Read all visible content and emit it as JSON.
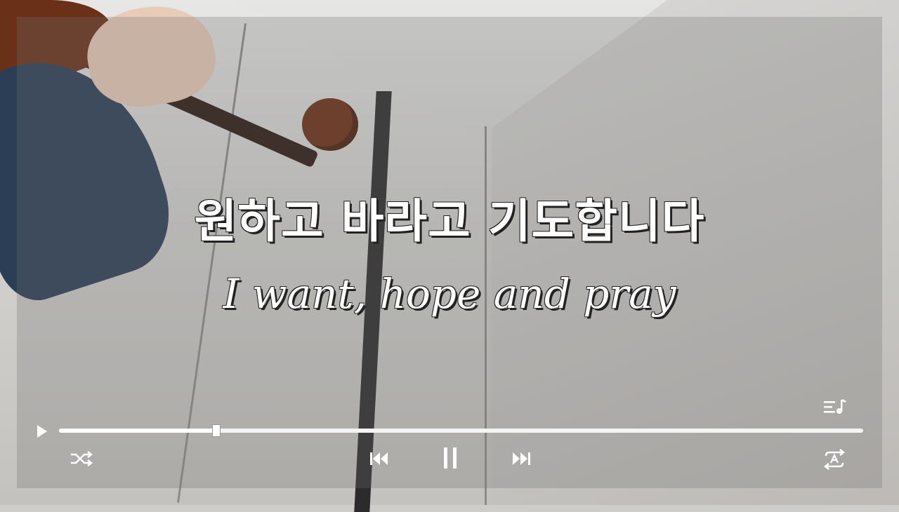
{
  "lyrics": {
    "korean": "원하고 바라고 기도합니다",
    "english": "I want, hope and pray"
  },
  "player": {
    "progress_fraction": 0.196,
    "icons": {
      "play": "play-icon",
      "shuffle": "shuffle-icon",
      "previous": "previous-track-icon",
      "pause": "pause-icon",
      "next": "next-track-icon",
      "lyrics": "lyrics-queue-icon",
      "repeat": "repeat-auto-icon"
    }
  },
  "colors": {
    "control": "#ffffff",
    "overlay": "#6e6e6e"
  }
}
